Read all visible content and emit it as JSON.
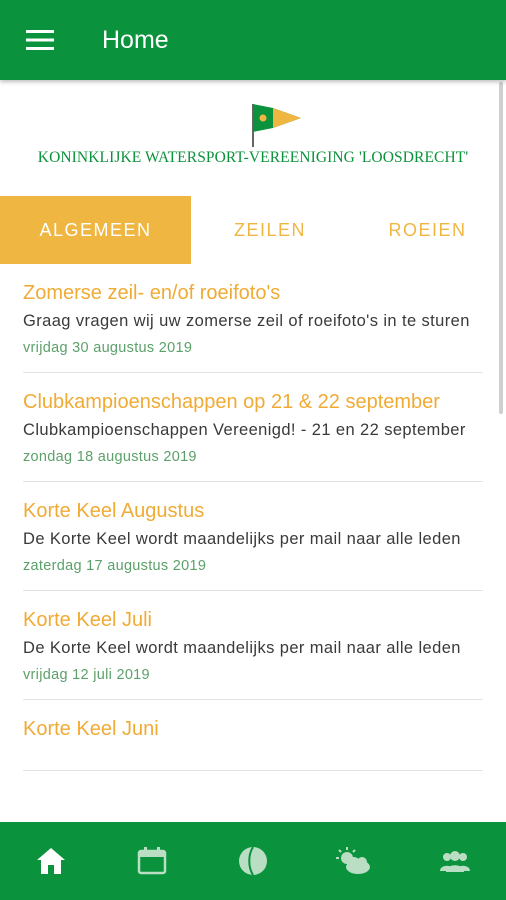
{
  "appbar": {
    "title": "Home",
    "menu_icon": "menu-icon"
  },
  "logo": {
    "text": "KONINKLIJKE WATERSPORT-VEREENIGING 'LOOSDRECHT'"
  },
  "tabs": [
    {
      "label": "ALGEMEEN",
      "active": true
    },
    {
      "label": "ZEILEN",
      "active": false
    },
    {
      "label": "ROEIEN",
      "active": false
    }
  ],
  "news": [
    {
      "title": "Zomerse zeil- en/of roeifoto's",
      "summary": "Graag vragen wij uw zomerse zeil of roeifoto's in te sturen",
      "date": "vrijdag 30 augustus 2019"
    },
    {
      "title": "Clubkampioenschappen op 21 & 22 september",
      "summary": "Clubkampioenschappen Vereenigd! - 21 en 22 september",
      "date": "zondag 18 augustus 2019"
    },
    {
      "title": "Korte Keel Augustus",
      "summary": "De Korte Keel wordt maandelijks per mail naar alle leden",
      "date": "zaterdag 17 augustus 2019"
    },
    {
      "title": "Korte Keel Juli",
      "summary": "De Korte Keel wordt maandelijks per mail naar alle leden",
      "date": "vrijdag 12 juli 2019"
    },
    {
      "title": "Korte Keel Juni",
      "summary": "",
      "date": ""
    }
  ],
  "bottom_nav": [
    {
      "icon": "home-icon"
    },
    {
      "icon": "calendar-icon"
    },
    {
      "icon": "ball-icon"
    },
    {
      "icon": "weather-icon"
    },
    {
      "icon": "members-icon"
    }
  ],
  "colors": {
    "primary": "#0b923c",
    "accent": "#f0b642",
    "date": "#5ca06a"
  }
}
